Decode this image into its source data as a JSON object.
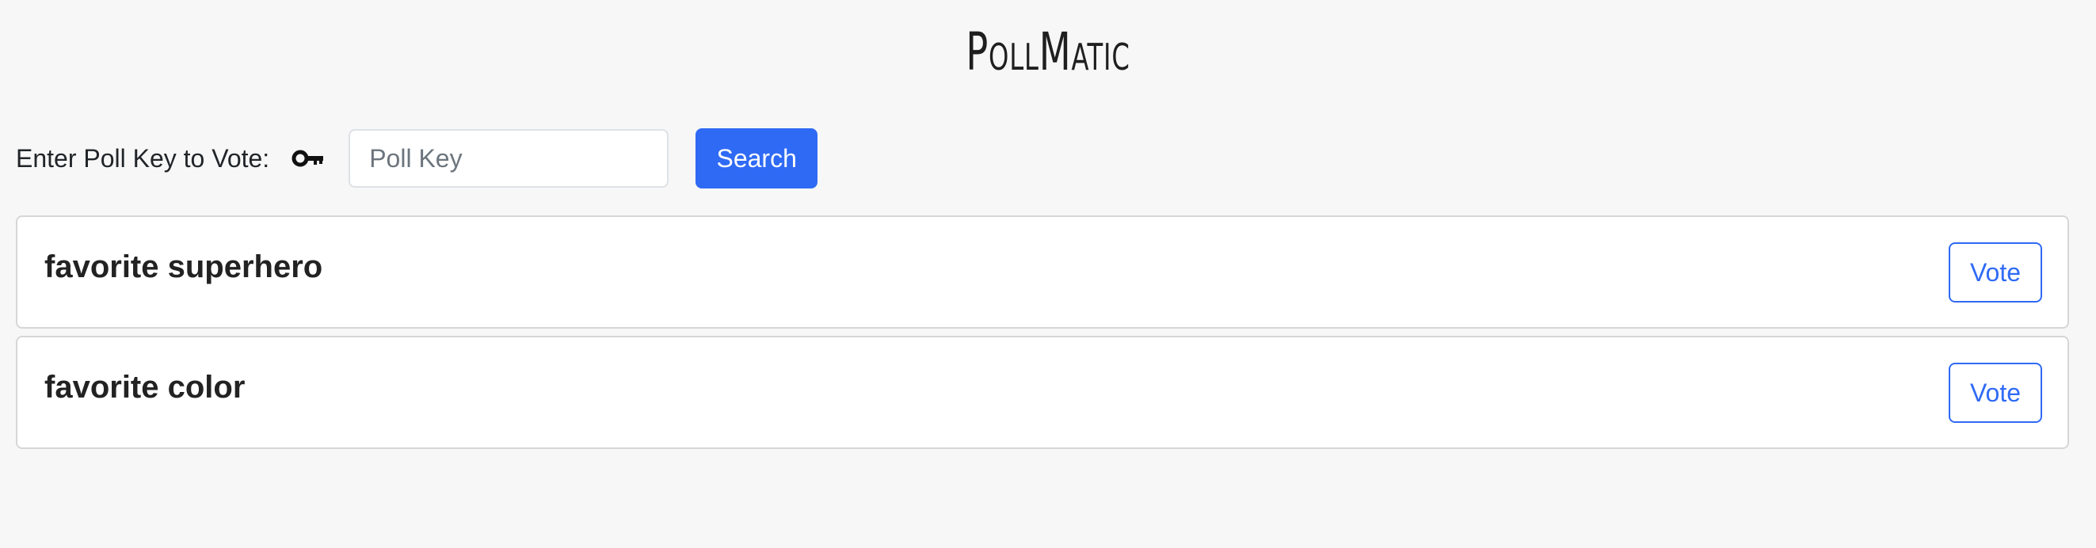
{
  "app": {
    "title": "PollMatic"
  },
  "search": {
    "label": "Enter Poll Key to Vote:",
    "key_icon": "key-icon",
    "placeholder": "Poll Key",
    "value": "",
    "button_label": "Search"
  },
  "polls": [
    {
      "title": "favorite superhero",
      "vote_label": "Vote"
    },
    {
      "title": "favorite color",
      "vote_label": "Vote"
    }
  ],
  "colors": {
    "background": "#f7f7f7",
    "primary": "#2f6af5",
    "card_border": "#d6d6d6"
  }
}
